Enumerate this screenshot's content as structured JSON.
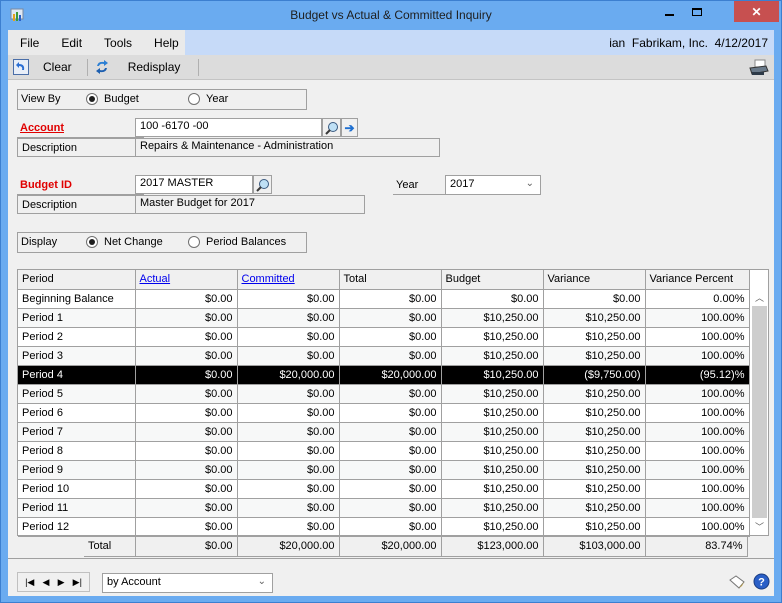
{
  "window": {
    "title": "Budget vs Actual & Committed Inquiry",
    "close_glyph": "✕"
  },
  "menu": {
    "items": [
      "File",
      "Edit",
      "Tools",
      "Help"
    ],
    "user": "ian",
    "company": "Fabrikam, Inc.",
    "date": "4/12/2017"
  },
  "toolbar": {
    "clear_label": "Clear",
    "redisplay_label": "Redisplay"
  },
  "view_by": {
    "label": "View By",
    "options": [
      "Budget",
      "Year"
    ],
    "selected": "Budget"
  },
  "account": {
    "label": "Account",
    "value": "100 -6170 -00",
    "description_label": "Description",
    "description": "Repairs & Maintenance - Administration"
  },
  "budget": {
    "label": "Budget ID",
    "value": "2017 MASTER",
    "description_label": "Description",
    "description": "Master Budget for 2017"
  },
  "year": {
    "label": "Year",
    "value": "2017"
  },
  "display": {
    "label": "Display",
    "options": [
      "Net Change",
      "Period Balances"
    ],
    "selected": "Net Change"
  },
  "grid": {
    "columns": [
      "Period",
      "Actual",
      "Committed",
      "Total",
      "Budget",
      "Variance",
      "Variance Percent"
    ],
    "rows": [
      [
        "Beginning Balance",
        "$0.00",
        "$0.00",
        "$0.00",
        "$0.00",
        "$0.00",
        "0.00%"
      ],
      [
        "Period 1",
        "$0.00",
        "$0.00",
        "$0.00",
        "$10,250.00",
        "$10,250.00",
        "100.00%"
      ],
      [
        "Period 2",
        "$0.00",
        "$0.00",
        "$0.00",
        "$10,250.00",
        "$10,250.00",
        "100.00%"
      ],
      [
        "Period 3",
        "$0.00",
        "$0.00",
        "$0.00",
        "$10,250.00",
        "$10,250.00",
        "100.00%"
      ],
      [
        "Period 4",
        "$0.00",
        "$20,000.00",
        "$20,000.00",
        "$10,250.00",
        "($9,750.00)",
        "(95.12)%"
      ],
      [
        "Period 5",
        "$0.00",
        "$0.00",
        "$0.00",
        "$10,250.00",
        "$10,250.00",
        "100.00%"
      ],
      [
        "Period 6",
        "$0.00",
        "$0.00",
        "$0.00",
        "$10,250.00",
        "$10,250.00",
        "100.00%"
      ],
      [
        "Period 7",
        "$0.00",
        "$0.00",
        "$0.00",
        "$10,250.00",
        "$10,250.00",
        "100.00%"
      ],
      [
        "Period 8",
        "$0.00",
        "$0.00",
        "$0.00",
        "$10,250.00",
        "$10,250.00",
        "100.00%"
      ],
      [
        "Period 9",
        "$0.00",
        "$0.00",
        "$0.00",
        "$10,250.00",
        "$10,250.00",
        "100.00%"
      ],
      [
        "Period 10",
        "$0.00",
        "$0.00",
        "$0.00",
        "$10,250.00",
        "$10,250.00",
        "100.00%"
      ],
      [
        "Period 11",
        "$0.00",
        "$0.00",
        "$0.00",
        "$10,250.00",
        "$10,250.00",
        "100.00%"
      ],
      [
        "Period 12",
        "$0.00",
        "$0.00",
        "$0.00",
        "$10,250.00",
        "$10,250.00",
        "100.00%"
      ]
    ],
    "selected_row": 4,
    "totals": {
      "label": "Total",
      "values": [
        "$0.00",
        "$20,000.00",
        "$20,000.00",
        "$123,000.00",
        "$103,000.00",
        "83.74%"
      ]
    }
  },
  "footer": {
    "sort_value": "by Account"
  },
  "colors": {
    "titlebar": "#6aabf0",
    "close_button": "#c75050",
    "required_label": "#e00000",
    "link": "#0000ee",
    "selected_row": "#000000"
  }
}
